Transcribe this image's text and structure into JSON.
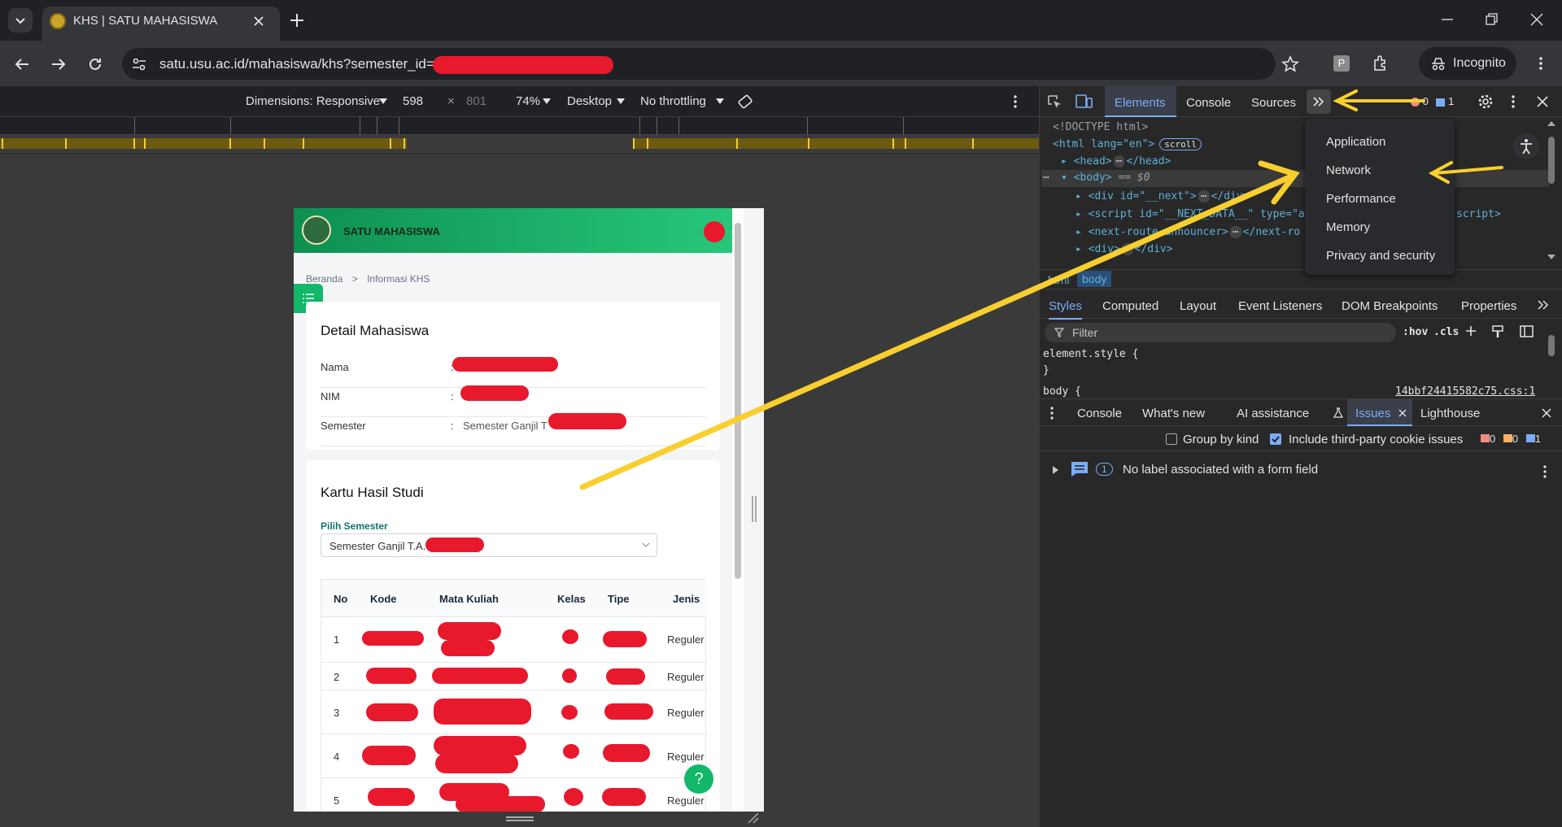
{
  "browser": {
    "tab_title": "KHS | SATU MAHASISWA",
    "url": "satu.usu.ac.id/mahasiswa/khs?semester_id=",
    "incognito_label": "Incognito",
    "extension_badge": "P"
  },
  "device_toolbar": {
    "dimensions_label": "Dimensions: Responsive",
    "width": "598",
    "times": "×",
    "height": "801",
    "zoom": "74%",
    "device": "Desktop",
    "throttling": "No throttling"
  },
  "page": {
    "app_title": "SATU MAHASISWA",
    "breadcrumb_home": "Beranda",
    "breadcrumb_sep": ">",
    "breadcrumb_current": "Informasi KHS",
    "detail_title": "Detail Mahasiswa",
    "fields": [
      {
        "label": "Nama",
        "colon": ":",
        "value": ""
      },
      {
        "label": "NIM",
        "colon": ":",
        "value": ""
      },
      {
        "label": "Semester",
        "colon": ":",
        "value": "Semester Ganjil T"
      }
    ],
    "khs_title": "Kartu Hasil Studi",
    "select_label": "Pilih Semester",
    "select_value": "Semester Ganjil T.A.",
    "table_headers": [
      "No",
      "Kode",
      "Mata Kuliah",
      "Kelas",
      "Tipe",
      "Jenis"
    ],
    "rows": [
      {
        "no": "1",
        "jenis": "Reguler"
      },
      {
        "no": "2",
        "jenis": "Reguler"
      },
      {
        "no": "3",
        "jenis": "Reguler"
      },
      {
        "no": "4",
        "jenis": "Reguler"
      },
      {
        "no": "5",
        "jenis": "Reguler"
      }
    ],
    "help_button": "?"
  },
  "devtools": {
    "tabs": [
      "Elements",
      "Console",
      "Sources"
    ],
    "more_tabs": "»",
    "error_count": "0",
    "message_count": "1",
    "dom_lines": [
      "<!DOCTYPE html>",
      "<html lang=\"en\">",
      "scroll",
      "<head>",
      "</head>",
      "<body>",
      "== $0",
      "<div id=\"__next\">",
      "</div>",
      "<script id=\"__NEXT_DATA__\" type=\"a",
      "script>",
      "<next-route-announcer>",
      "</next-ro",
      "<div>",
      "</div>"
    ],
    "breadcrumb": [
      "html",
      "body"
    ],
    "menu_items": [
      "Application",
      "Network",
      "Performance",
      "Memory",
      "Privacy and security"
    ],
    "style_tabs": [
      "Styles",
      "Computed",
      "Layout",
      "Event Listeners",
      "DOM Breakpoints",
      "Properties"
    ],
    "filter_placeholder": "Filter",
    "hov": ":hov",
    "cls": ".cls",
    "element_style": "element.style {",
    "close_brace": "}",
    "body_rule": "body {",
    "body_source": "14bbf24415582c75.css:1",
    "drawer_tabs": [
      "Console",
      "What's new",
      "AI assistance",
      "Issues",
      "Lighthouse"
    ],
    "group_by_kind": "Group by kind",
    "include_third_party": "Include third-party cookie issues",
    "issue_counts": {
      "red": "0",
      "orange": "0",
      "blue": "1"
    },
    "issue_count": "1",
    "issue_text": "No label associated with a form field"
  },
  "colors": {
    "accent": "#7cacf8",
    "brand_green": "#12b76a",
    "annotation_arrow": "#f9cf2f",
    "redaction": "#e8192c"
  }
}
